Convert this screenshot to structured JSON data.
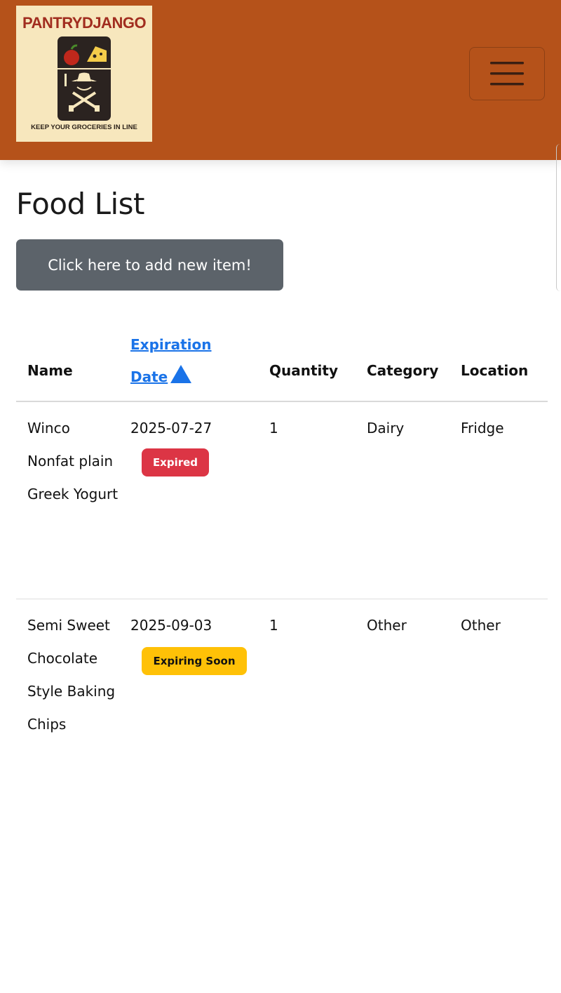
{
  "navbar": {
    "brand_name": "PANTRYDJANGO",
    "brand_tagline": "KEEP YOUR GROCERIES IN LINE",
    "brand_color": "#b5521a",
    "menu_icon": "hamburger-icon"
  },
  "page": {
    "title": "Food List",
    "add_button_label": "Click here to add new item!"
  },
  "table": {
    "columns": {
      "name": "Name",
      "expiration": "Expiration Date",
      "quantity": "Quantity",
      "category": "Category",
      "location": "Location"
    },
    "sort_icon": "sort-ascending-icon",
    "rows": [
      {
        "name": "Winco Nonfat plain Greek Yogurt",
        "expiration": "2025-07-27",
        "status": "Expired",
        "status_color": "#dc3545",
        "quantity": "1",
        "category": "Dairy",
        "location": "Fridge"
      },
      {
        "name": "Semi Sweet Chocolate Style Baking Chips",
        "expiration": "2025-09-03",
        "status": "Expiring Soon",
        "status_color": "#ffc107",
        "quantity": "1",
        "category": "Other",
        "location": "Other"
      }
    ]
  }
}
